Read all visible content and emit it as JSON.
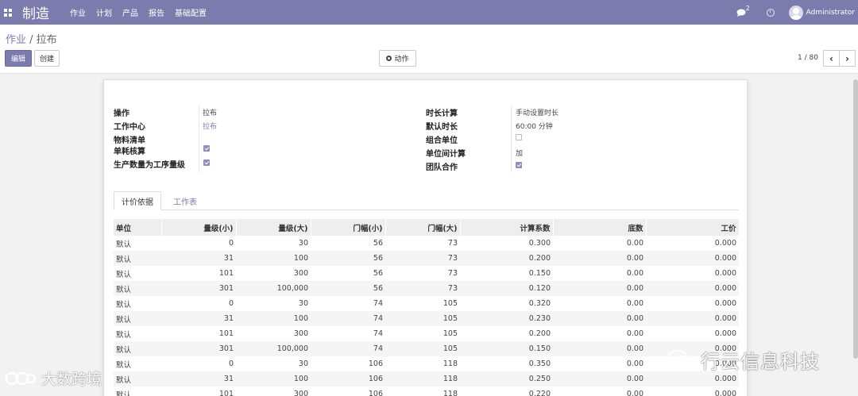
{
  "navbar": {
    "app_title": "制造",
    "menu": [
      "作业",
      "计划",
      "产品",
      "报告",
      "基础配置"
    ],
    "chat_count": "2",
    "user_name": "Administrator"
  },
  "control": {
    "breadcrumb_parent": "作业",
    "breadcrumb_sep": " / ",
    "breadcrumb_current": "拉布",
    "edit_label": "编辑",
    "create_label": "创建",
    "action_label": "动作",
    "pager": "1 / 80",
    "prev": "‹",
    "next": "›"
  },
  "form": {
    "left": [
      {
        "label": "操作",
        "value": "拉布"
      },
      {
        "label": "工作中心",
        "value": "拉布"
      },
      {
        "label": "物料清单",
        "value": ""
      },
      {
        "label": "单耗核算",
        "checked": true
      },
      {
        "label": "生产数量为工序量级",
        "checked": true
      }
    ],
    "right": [
      {
        "label": "时长计算",
        "value": "手动设置时长"
      },
      {
        "label": "默认时长",
        "value": "60:00 分钟"
      },
      {
        "label": "组合单位",
        "checked": false
      },
      {
        "label": "单位间计算",
        "value": "加"
      },
      {
        "label": "团队合作",
        "checked": true
      }
    ]
  },
  "tabs": [
    "计价依据",
    "工作表"
  ],
  "table": {
    "headers": [
      "单位",
      "量级(小)",
      "量级(大)",
      "门幅(小)",
      "门幅(大)",
      "计算系数",
      "底数",
      "工价"
    ],
    "rows": [
      [
        "默认",
        "0",
        "30",
        "56",
        "73",
        "0.300",
        "0.00",
        "0.000"
      ],
      [
        "默认",
        "31",
        "100",
        "56",
        "73",
        "0.200",
        "0.00",
        "0.000"
      ],
      [
        "默认",
        "101",
        "300",
        "56",
        "73",
        "0.150",
        "0.00",
        "0.000"
      ],
      [
        "默认",
        "301",
        "100,000",
        "56",
        "73",
        "0.120",
        "0.00",
        "0.000"
      ],
      [
        "默认",
        "0",
        "30",
        "74",
        "105",
        "0.320",
        "0.00",
        "0.000"
      ],
      [
        "默认",
        "31",
        "100",
        "74",
        "105",
        "0.230",
        "0.00",
        "0.000"
      ],
      [
        "默认",
        "101",
        "300",
        "74",
        "105",
        "0.200",
        "0.00",
        "0.000"
      ],
      [
        "默认",
        "301",
        "100,000",
        "74",
        "105",
        "0.150",
        "0.00",
        "0.000"
      ],
      [
        "默认",
        "0",
        "30",
        "106",
        "118",
        "0.350",
        "0.00",
        "0.000"
      ],
      [
        "默认",
        "31",
        "100",
        "106",
        "118",
        "0.250",
        "0.00",
        "0.000"
      ],
      [
        "默认",
        "101",
        "300",
        "106",
        "118",
        "0.220",
        "0.00",
        "0.000"
      ]
    ]
  },
  "watermark": {
    "left_text": "大数跨境",
    "right_text": "行云信息科技"
  },
  "colors": {
    "brand": "#7c7bad",
    "checkbox_on": "#8f8ebb"
  }
}
